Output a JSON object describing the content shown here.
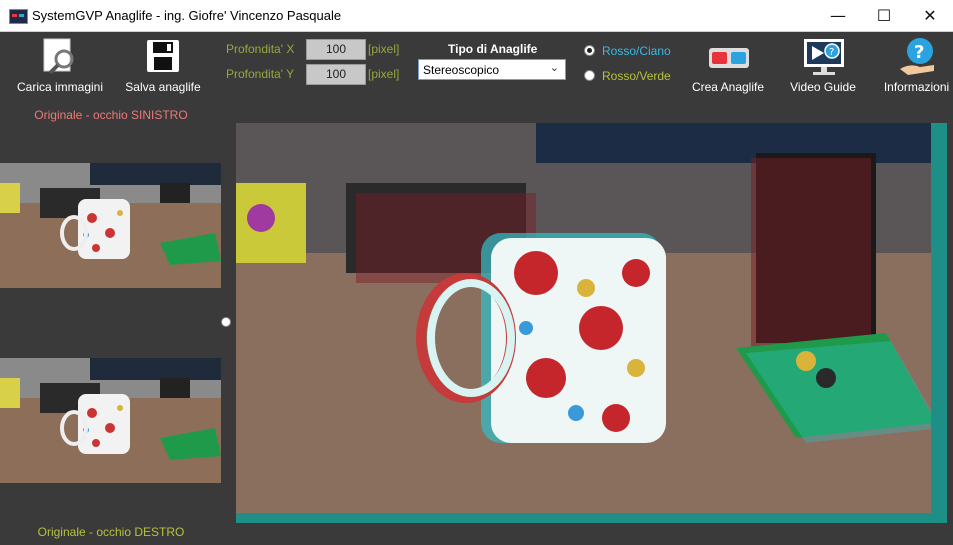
{
  "window": {
    "title": "SystemGVP Anaglife - ing. Giofre' Vincenzo Pasquale"
  },
  "toolbar": {
    "load_label": "Carica immagini",
    "save_label": "Salva anaglife",
    "create_label": "Crea Anaglife",
    "video_label": "Video Guide",
    "info_label": "Informazioni"
  },
  "depth": {
    "x_label": "Profondita' X",
    "y_label": "Profondita' Y",
    "x_value": "100",
    "y_value": "100",
    "unit": "[pixel]"
  },
  "anaglyph_type": {
    "label": "Tipo di Anaglife",
    "selected": "Stereoscopico"
  },
  "color_mode": {
    "options": [
      {
        "label": "Rosso/Ciano",
        "selected": true
      },
      {
        "label": "Rosso/Verde",
        "selected": false
      }
    ]
  },
  "captions": {
    "left_eye": "Originale - occhio SINISTRO",
    "right_eye": "Originale - occhio DESTRO"
  },
  "colors": {
    "left_caption": "#f07878",
    "right_caption": "#b7c23a",
    "depth_label": "#9aa63c",
    "radio_cyan": "#3cb8e8",
    "radio_green": "#b7c23a"
  }
}
